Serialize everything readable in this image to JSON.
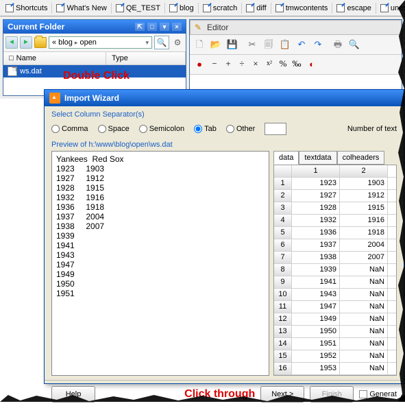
{
  "shortcuts": [
    "Shortcuts",
    "What's New",
    "QE_TEST",
    "blog",
    "scratch",
    "diff",
    "tmwcontents",
    "escape",
    "unescap"
  ],
  "currentFolder": {
    "title": "Current Folder",
    "breadcrumb": [
      "«",
      "blog",
      "open"
    ],
    "headers": {
      "name": "Name",
      "type": "Type"
    },
    "file": "ws.dat",
    "annotation": "Double Click"
  },
  "editor": {
    "title": "Editor"
  },
  "wizard": {
    "title": "Import Wizard",
    "sepLabel": "Select Column Separator(s)",
    "radios": {
      "comma": "Comma",
      "space": "Space",
      "semicolon": "Semicolon",
      "tab": "Tab",
      "other": "Other"
    },
    "numText": "Number of text",
    "previewLabel": "Preview of h:\\www\\blog\\open\\ws.dat",
    "previewLines": [
      "Yankees  Red Sox",
      "1923     1903",
      "1927     1912",
      "1928     1915",
      "1932     1916",
      "1936     1918",
      "1937     2004",
      "1938     2007",
      "1939",
      "1941",
      "1943",
      "1947",
      "1949",
      "1950",
      "1951"
    ],
    "tabs": [
      "data",
      "textdata",
      "colheaders"
    ],
    "gridCols": [
      "",
      "1",
      "2"
    ],
    "gridRows": [
      {
        "n": "1",
        "c1": "1923",
        "c2": "1903"
      },
      {
        "n": "2",
        "c1": "1927",
        "c2": "1912"
      },
      {
        "n": "3",
        "c1": "1928",
        "c2": "1915"
      },
      {
        "n": "4",
        "c1": "1932",
        "c2": "1916"
      },
      {
        "n": "5",
        "c1": "1936",
        "c2": "1918"
      },
      {
        "n": "6",
        "c1": "1937",
        "c2": "2004"
      },
      {
        "n": "7",
        "c1": "1938",
        "c2": "2007"
      },
      {
        "n": "8",
        "c1": "1939",
        "c2": "NaN"
      },
      {
        "n": "9",
        "c1": "1941",
        "c2": "NaN"
      },
      {
        "n": "10",
        "c1": "1943",
        "c2": "NaN"
      },
      {
        "n": "11",
        "c1": "1947",
        "c2": "NaN"
      },
      {
        "n": "12",
        "c1": "1949",
        "c2": "NaN"
      },
      {
        "n": "13",
        "c1": "1950",
        "c2": "NaN"
      },
      {
        "n": "14",
        "c1": "1951",
        "c2": "NaN"
      },
      {
        "n": "15",
        "c1": "1952",
        "c2": "NaN"
      },
      {
        "n": "16",
        "c1": "1953",
        "c2": "NaN"
      }
    ],
    "buttons": {
      "help": "Help",
      "next": "Next >",
      "finish": "Finish",
      "generate": "Generat"
    },
    "annotation": "Click through"
  }
}
